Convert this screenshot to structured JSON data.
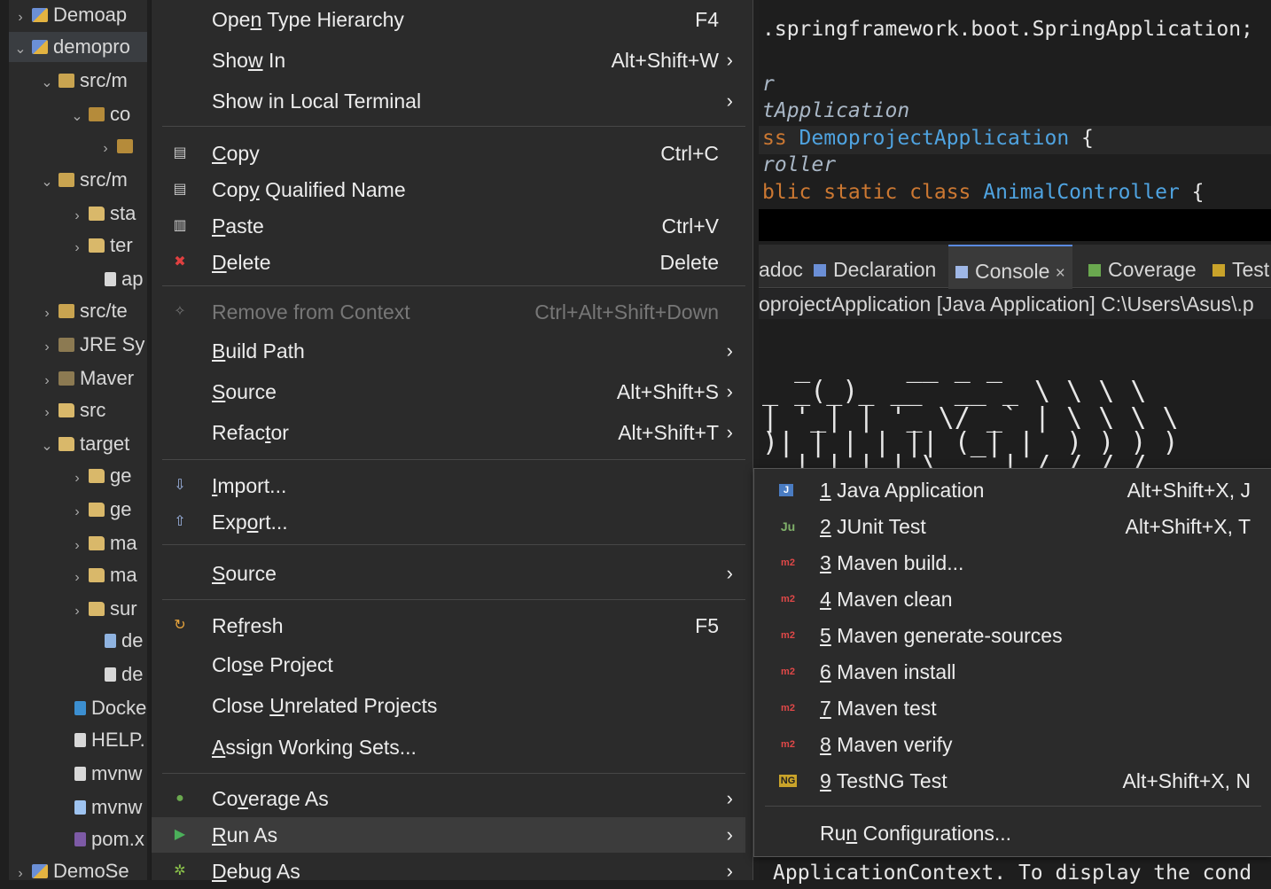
{
  "explorer": {
    "rows": [
      {
        "label": "Demoap",
        "icon": "project-icon"
      },
      {
        "label": "demopro",
        "icon": "project-icon"
      },
      {
        "label": "src/m",
        "icon": "source-folder-icon"
      },
      {
        "label": "co",
        "icon": "package-icon"
      },
      {
        "label": "",
        "icon": "java-file-icon"
      },
      {
        "label": "src/m",
        "icon": "source-folder-icon"
      },
      {
        "label": "sta",
        "icon": "folder-icon"
      },
      {
        "label": "ter",
        "icon": "folder-icon"
      },
      {
        "label": "ap",
        "icon": "file-icon"
      },
      {
        "label": "src/te",
        "icon": "source-folder-icon"
      },
      {
        "label": "JRE Sy",
        "icon": "library-icon"
      },
      {
        "label": "Maver",
        "icon": "library-icon"
      },
      {
        "label": "src",
        "icon": "folder-icon"
      },
      {
        "label": "target",
        "icon": "folder-icon"
      },
      {
        "label": "ge",
        "icon": "folder-icon"
      },
      {
        "label": "ge",
        "icon": "folder-icon"
      },
      {
        "label": "ma",
        "icon": "folder-icon"
      },
      {
        "label": "ma",
        "icon": "folder-icon"
      },
      {
        "label": "sur",
        "icon": "folder-icon"
      },
      {
        "label": "de",
        "icon": "image-file-icon"
      },
      {
        "label": "de",
        "icon": "file-icon"
      },
      {
        "label": "Docke",
        "icon": "docker-file-icon"
      },
      {
        "label": "HELP.",
        "icon": "file-icon"
      },
      {
        "label": "mvnw",
        "icon": "file-icon"
      },
      {
        "label": "mvnw",
        "icon": "file-icon"
      },
      {
        "label": "pom.x",
        "icon": "xml-file-icon"
      },
      {
        "label": "DemoSe",
        "icon": "project-icon"
      }
    ]
  },
  "editor": {
    "line1": ".springframework.boot.SpringApplication;",
    "line2": "r",
    "line3": "tApplication",
    "line4_kw": "ss ",
    "line4_cls": "DemoprojectApplication",
    "line4_end": " {",
    "line5": "roller",
    "line6_kw": "blic static class ",
    "line6_cls": "AnimalController",
    "line6_end": " {"
  },
  "console": {
    "tabs": [
      {
        "label": "adoc",
        "icon": ""
      },
      {
        "label": "Declaration",
        "icon": "declaration-icon"
      },
      {
        "label": "Console",
        "icon": "console-icon",
        "close": "×"
      },
      {
        "label": "Coverage",
        "icon": "coverage-icon"
      },
      {
        "label": "Test",
        "icon": "testng-icon"
      }
    ],
    "header": "oprojectApplication [Java Application] C:\\Users\\Asus\\.p",
    "ascii": [
      "  _      __ _ _",
      "_ _(_)_ __  __ _ \\ \\ \\ \\",
      "| '_| | '_ \\/ _` | \\ \\ \\ \\",
      ")| | | | || (_| |  ) ) ) )",
      "  |_|_| |_\\__, | / / / /"
    ],
    "bottom_text": "ApplicationContext. To display the cond"
  },
  "context_menu": {
    "items": [
      {
        "pre": "Ope",
        "u": "n",
        "post": " Type Hierarchy",
        "shortcut": "F4"
      },
      {
        "pre": "Sho",
        "u": "w",
        "post": " In",
        "shortcut": "Alt+Shift+W",
        "arrow": "›"
      },
      {
        "pre": "Show in Local Terminal",
        "u": "",
        "post": "",
        "arrow": "›"
      },
      {
        "pre": "",
        "u": "C",
        "post": "opy",
        "shortcut": "Ctrl+C",
        "icon": "copy-icon"
      },
      {
        "pre": "Cop",
        "u": "y",
        "post": " Qualified Name",
        "icon": "copy-qualified-icon"
      },
      {
        "pre": "",
        "u": "P",
        "post": "aste",
        "shortcut": "Ctrl+V",
        "icon": "paste-icon"
      },
      {
        "pre": "",
        "u": "D",
        "post": "elete",
        "shortcut": "Delete",
        "icon": "delete-icon"
      },
      {
        "pre": "Remove from Context",
        "u": "",
        "post": "",
        "shortcut": "Ctrl+Alt+Shift+Down",
        "icon": "remove-context-icon"
      },
      {
        "pre": "",
        "u": "B",
        "post": "uild Path",
        "arrow": "›"
      },
      {
        "pre": "",
        "u": "S",
        "post": "ource",
        "shortcut": "Alt+Shift+S",
        "arrow": "›"
      },
      {
        "pre": "Refac",
        "u": "t",
        "post": "or",
        "shortcut": "Alt+Shift+T",
        "arrow": "›"
      },
      {
        "pre": "",
        "u": "I",
        "post": "mport...",
        "icon": "import-icon"
      },
      {
        "pre": "Exp",
        "u": "o",
        "post": "rt...",
        "icon": "export-icon"
      },
      {
        "pre": "",
        "u": "S",
        "post": "ource",
        "arrow": "›"
      },
      {
        "pre": "Re",
        "u": "f",
        "post": "resh",
        "shortcut": "F5",
        "icon": "refresh-icon"
      },
      {
        "pre": "Clo",
        "u": "s",
        "post": "e Project"
      },
      {
        "pre": "Close ",
        "u": "U",
        "post": "nrelated Projects"
      },
      {
        "pre": "",
        "u": "A",
        "post": "ssign Working Sets..."
      },
      {
        "pre": "Co",
        "u": "v",
        "post": "erage As",
        "arrow": "›",
        "icon": "coverage-icon"
      },
      {
        "pre": "",
        "u": "R",
        "post": "un As",
        "arrow": "›",
        "icon": "run-icon"
      },
      {
        "pre": "",
        "u": "D",
        "post": "ebug As",
        "arrow": "›",
        "icon": "debug-icon"
      }
    ]
  },
  "run_as_submenu": {
    "items": [
      {
        "num": "1",
        "label": " Java Application",
        "shortcut": "Alt+Shift+X, J",
        "icon_text": "J"
      },
      {
        "num": "2",
        "label": " JUnit Test",
        "shortcut": "Alt+Shift+X, T",
        "icon_text": "Ju"
      },
      {
        "num": "3",
        "label": " Maven build...",
        "shortcut": "",
        "icon_text": "m2"
      },
      {
        "num": "4",
        "label": " Maven clean",
        "shortcut": "",
        "icon_text": "m2"
      },
      {
        "num": "5",
        "label": " Maven generate-sources",
        "shortcut": "",
        "icon_text": "m2"
      },
      {
        "num": "6",
        "label": " Maven install",
        "shortcut": "",
        "icon_text": "m2"
      },
      {
        "num": "7",
        "label": " Maven test",
        "shortcut": "",
        "icon_text": "m2"
      },
      {
        "num": "8",
        "label": " Maven verify",
        "shortcut": "",
        "icon_text": "m2"
      },
      {
        "num": "9",
        "label": " TestNG Test",
        "shortcut": "Alt+Shift+X, N",
        "icon_text": "NG"
      }
    ],
    "run_config": {
      "pre": "Ru",
      "u": "n",
      "post": " Configurations..."
    }
  },
  "colors": {
    "menu_bg": "#2b2b2b",
    "hover_bg": "#3c3c3c",
    "editor_bg": "#1e1e1e",
    "keyword": "#cc7832",
    "class_name": "#4fa3e0"
  }
}
